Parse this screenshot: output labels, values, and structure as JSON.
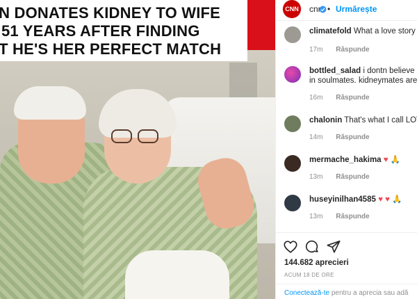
{
  "post": {
    "headline": {
      "line1": "AN DONATES KIDNEY TO WIFE",
      "line2": "F 51 YEARS AFTER FINDING",
      "line3": "UT HE'S HER PERFECT MATCH"
    }
  },
  "header": {
    "username": "cnn",
    "separator": "•",
    "follow_label": "Urmărește",
    "logo_text": "CNN",
    "verified_icon": "verified-badge-icon"
  },
  "comments": [
    {
      "username": "climatefold",
      "text": "What a love story",
      "emoji": "♥",
      "time": "17m",
      "reply": "Răspunde"
    },
    {
      "username": "bottled_salad",
      "text": "i dontn believe in soulmates. kidneymates are bett",
      "time": "16m",
      "reply": "Răspunde"
    },
    {
      "username": "chalonin",
      "text": "That's what I call LOVE",
      "time": "14m",
      "reply": "Răspunde"
    },
    {
      "username": "mermache_hakima",
      "text": "",
      "emoji": "♥ 🙏",
      "time": "13m",
      "reply": "Răspunde"
    },
    {
      "username": "huseyinilhan4585",
      "text": "",
      "emoji": "♥ ♥ 🙏",
      "time": "13m",
      "reply": "Răspunde"
    }
  ],
  "actions": {
    "like_icon": "heart-outline-icon",
    "comment_icon": "comment-bubble-icon",
    "share_icon": "paper-plane-icon"
  },
  "likes_text": "144.682 aprecieri",
  "posted_ago": "ACUM 18 DE ORE",
  "footer": {
    "login_link": "Conectează-te",
    "rest": "pentru a aprecia sau adă"
  }
}
